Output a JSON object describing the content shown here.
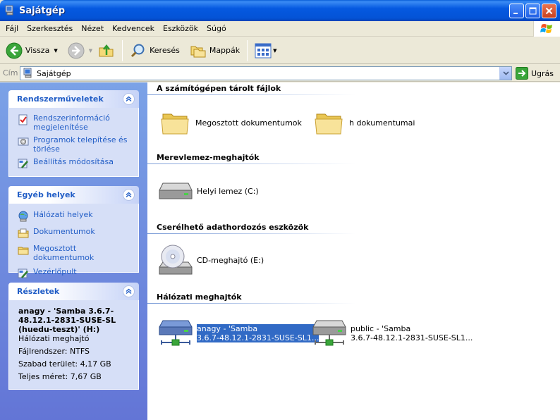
{
  "window": {
    "title": "Sajátgép"
  },
  "menu": [
    "Fájl",
    "Szerkesztés",
    "Nézet",
    "Kedvencek",
    "Eszközök",
    "Súgó"
  ],
  "toolbar": {
    "back_label": "Vissza",
    "search_label": "Keresés",
    "folders_label": "Mappák"
  },
  "address": {
    "label": "Cím",
    "value": "Sajátgép",
    "go_label": "Ugrás"
  },
  "sidebar": {
    "system_tasks": {
      "title": "Rendszerműveletek",
      "items": [
        {
          "label": "Rendszerinformáció megjelenítése",
          "icon": "system-info-icon"
        },
        {
          "label": "Programok telepítése és törlése",
          "icon": "add-remove-programs-icon"
        },
        {
          "label": "Beállítás módosítása",
          "icon": "control-panel-icon"
        }
      ]
    },
    "other_places": {
      "title": "Egyéb helyek",
      "items": [
        {
          "label": "Hálózati helyek",
          "icon": "network-places-icon"
        },
        {
          "label": "Dokumentumok",
          "icon": "my-documents-icon"
        },
        {
          "label": "Megosztott dokumentumok",
          "icon": "shared-folder-icon"
        },
        {
          "label": "Vezérlőpult",
          "icon": "control-panel-icon"
        }
      ]
    },
    "details": {
      "title": "Részletek",
      "name": "anagy - 'Samba 3.6.7-48.12.1-2831-SUSE-SL (huedu-teszt)' (H:)",
      "type": "Hálózati meghajtó",
      "filesystem": "Fájlrendszer: NTFS",
      "free": "Szabad terület: 4,17 GB",
      "total": "Teljes méret: 7,67 GB"
    }
  },
  "groups": [
    {
      "title": "A számítógépen tárolt fájlok"
    },
    {
      "title": "Merevlemez-meghajtók"
    },
    {
      "title": "Cserélhető adathordozós eszközök"
    },
    {
      "title": "Hálózati meghajtók"
    }
  ],
  "items": {
    "shared_docs": {
      "label": "Megosztott dokumentumok"
    },
    "h_docs": {
      "label": "h dokumentumai"
    },
    "local_disk": {
      "label": "Helyi lemez (C:)"
    },
    "cd_drive": {
      "label": "CD-meghajtó (E:)"
    },
    "net_anagy": {
      "line1": "anagy - 'Samba",
      "line2": "3.6.7-48.12.1-2831-SUSE-SL1..."
    },
    "net_public": {
      "line1": "public - 'Samba",
      "line2": "3.6.7-48.12.1-2831-SUSE-SL1..."
    }
  },
  "colors": {
    "titlebar": "#0453d6",
    "sidebar_link": "#215dc6",
    "selection": "#316ac5"
  }
}
